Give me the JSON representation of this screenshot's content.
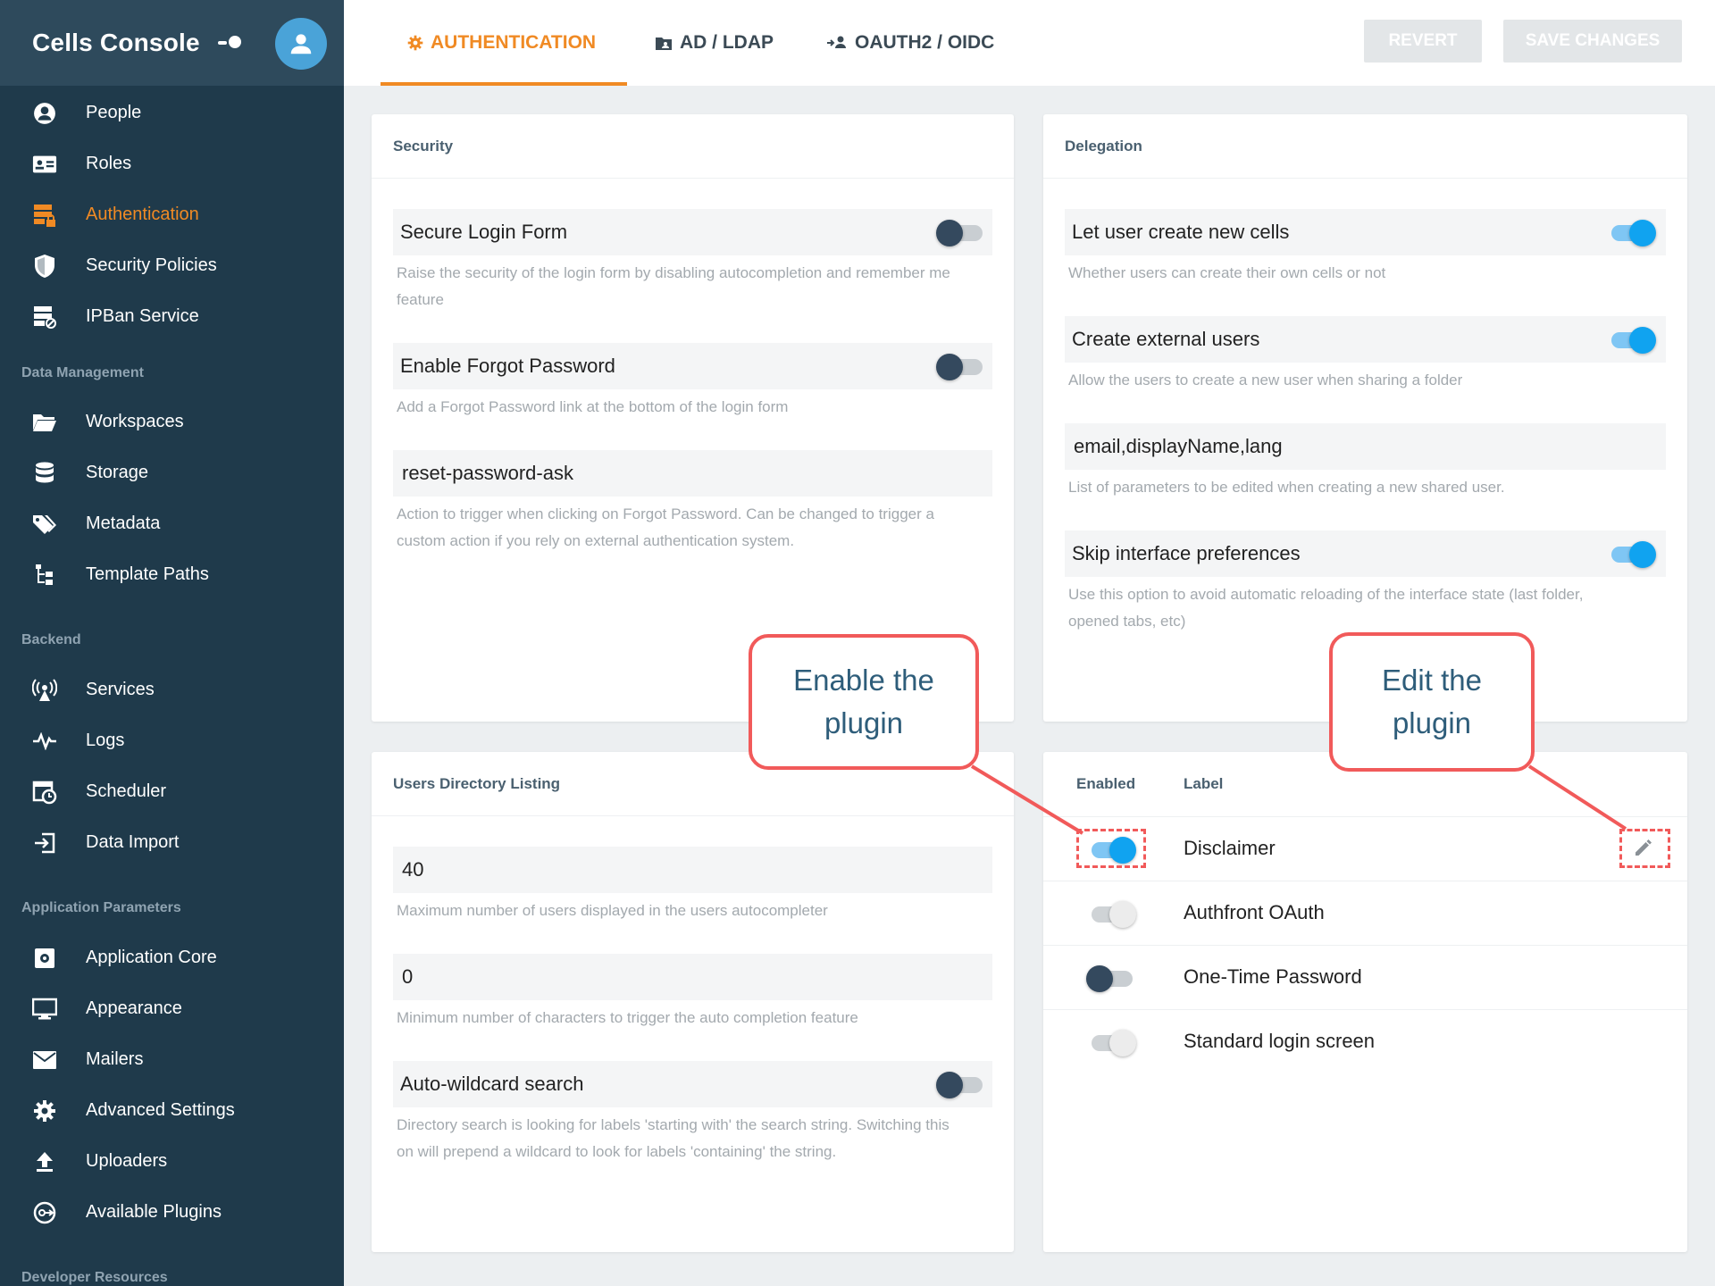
{
  "sidebar": {
    "title": "Cells Console",
    "items": [
      {
        "label": "People",
        "icon": "person-circle-icon"
      },
      {
        "label": "Roles",
        "icon": "id-card-icon"
      },
      {
        "label": "Authentication",
        "icon": "server-lock-icon",
        "active": true
      },
      {
        "label": "Security Policies",
        "icon": "shield-icon"
      },
      {
        "label": "IPBan Service",
        "icon": "server-ban-icon"
      },
      {
        "label": "Workspaces",
        "icon": "folder-open-icon"
      },
      {
        "label": "Storage",
        "icon": "database-icon"
      },
      {
        "label": "Metadata",
        "icon": "tags-icon"
      },
      {
        "label": "Template Paths",
        "icon": "file-tree-icon"
      },
      {
        "label": "Services",
        "icon": "broadcast-icon"
      },
      {
        "label": "Logs",
        "icon": "pulse-icon"
      },
      {
        "label": "Scheduler",
        "icon": "calendar-clock-icon"
      },
      {
        "label": "Data Import",
        "icon": "import-icon"
      },
      {
        "label": "Application Core",
        "icon": "chip-icon"
      },
      {
        "label": "Appearance",
        "icon": "monitor-icon"
      },
      {
        "label": "Mailers",
        "icon": "mail-icon"
      },
      {
        "label": "Advanced Settings",
        "icon": "gear-icon"
      },
      {
        "label": "Uploaders",
        "icon": "upload-icon"
      },
      {
        "label": "Available Plugins",
        "icon": "plugin-icon"
      }
    ],
    "sections": [
      "Data Management",
      "Backend",
      "Application Parameters",
      "Developer Resources"
    ]
  },
  "tabs": [
    {
      "label": "AUTHENTICATION",
      "icon": "gear-icon",
      "active": true
    },
    {
      "label": "AD / LDAP",
      "icon": "folder-account-icon"
    },
    {
      "label": "OAUTH2 / OIDC",
      "icon": "account-network-icon"
    }
  ],
  "actions": {
    "revert": "REVERT",
    "save": "SAVE CHANGES"
  },
  "security": {
    "title": "Security",
    "secure_login": {
      "label": "Secure Login Form",
      "desc1": "Raise the security of the login form by disabling autocompletion and remember me",
      "desc2": "feature",
      "enabled": false
    },
    "forgot_password": {
      "label": "Enable Forgot Password",
      "desc": "Add a Forgot Password link at the bottom of the login form",
      "enabled": false
    },
    "forgot_action": {
      "value": "reset-password-ask",
      "desc1": "Action to trigger when clicking on Forgot Password. Can be changed to trigger a",
      "desc2": "custom action if you rely on external authentication system."
    }
  },
  "delegation": {
    "title": "Delegation",
    "create_cells": {
      "label": "Let user create new cells",
      "desc": "Whether users can create their own cells or not",
      "enabled": true
    },
    "external_users": {
      "label": "Create external users",
      "desc": "Allow the users to create a new user when sharing a folder",
      "enabled": true
    },
    "params": {
      "value": "email,displayName,lang",
      "desc": "List of parameters to be edited when creating a new shared user."
    },
    "skip_prefs": {
      "label": "Skip interface preferences",
      "desc1": "Use this option to avoid automatic reloading of the interface state (last folder,",
      "desc2": "opened tabs, etc)",
      "enabled": true
    }
  },
  "users_dir": {
    "title": "Users Directory Listing",
    "max_users": {
      "value": "40",
      "desc": "Maximum number of users displayed in the users autocompleter"
    },
    "min_chars": {
      "value": "0",
      "desc": "Minimum number of characters to trigger the auto completion feature"
    },
    "wildcard": {
      "label": "Auto-wildcard search",
      "desc1": "Directory search is looking for labels 'starting with' the search string. Switching this",
      "desc2": "on will prepend a wildcard to look for labels 'containing' the string.",
      "enabled": false
    }
  },
  "plugins": {
    "col_enabled": "Enabled",
    "col_label": "Label",
    "rows": [
      {
        "label": "Disclaimer",
        "state": "on"
      },
      {
        "label": "Authfront OAuth",
        "state": "disabled"
      },
      {
        "label": "One-Time Password",
        "state": "off"
      },
      {
        "label": "Standard login screen",
        "state": "disabled"
      }
    ]
  },
  "callouts": {
    "enable_line1": "Enable the",
    "enable_line2": "plugin",
    "edit_line1": "Edit the",
    "edit_line2": "plugin"
  },
  "colors": {
    "accent": "#f08a24",
    "sidebar": "#1f3a4b",
    "toggle_on": "#10a3f0",
    "callout": "#f15a5a"
  }
}
